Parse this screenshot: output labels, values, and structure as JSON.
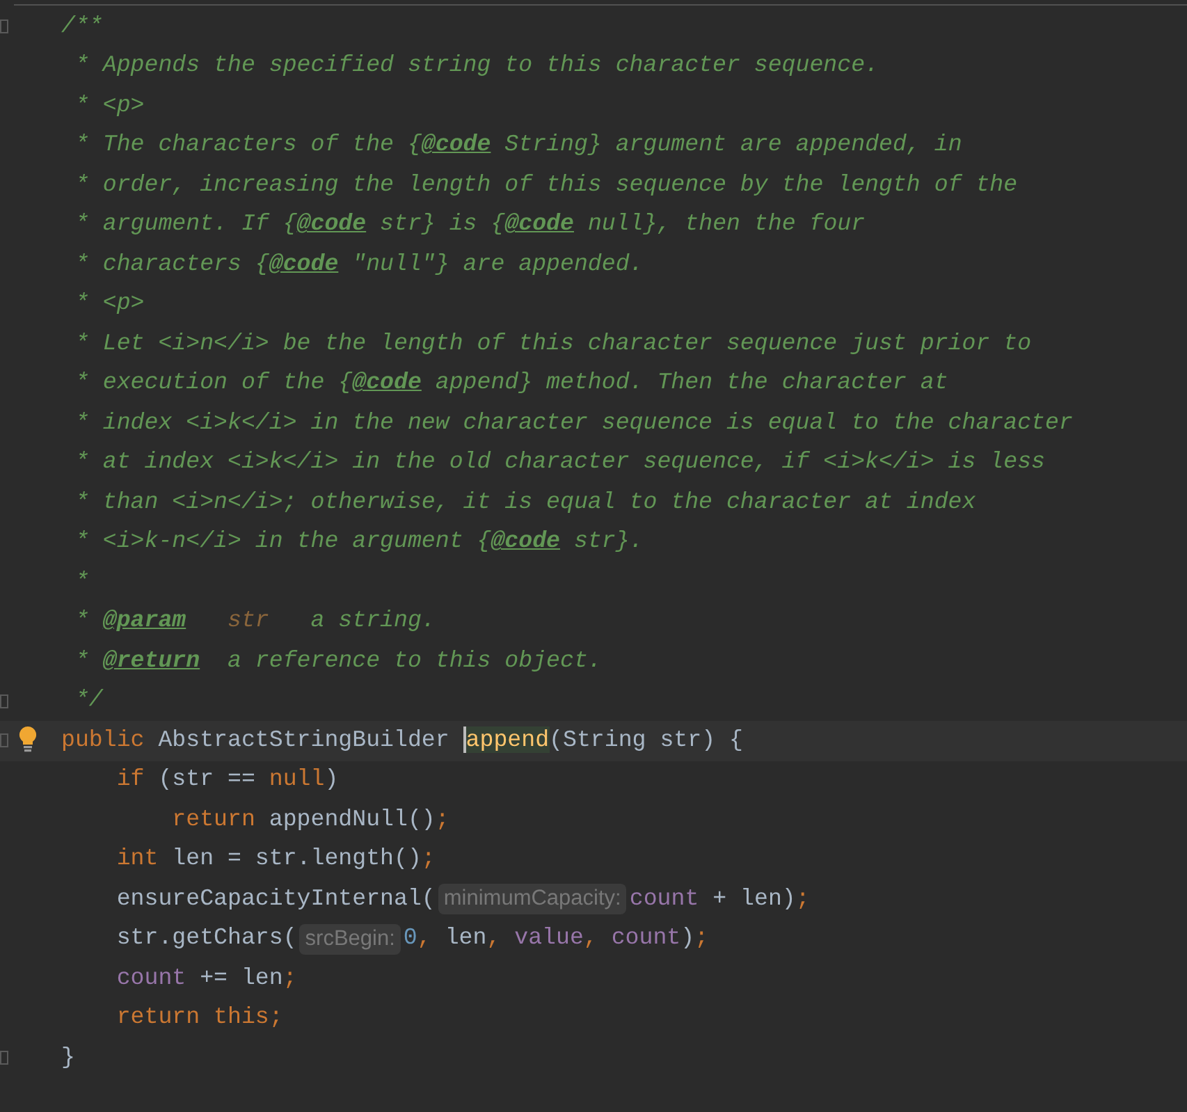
{
  "doc_comment": [
    {
      "tokens": [
        {
          "kind": "comment",
          "text": "/**"
        }
      ]
    },
    {
      "tokens": [
        {
          "kind": "comment",
          "text": " * Appends the specified string to this character sequence."
        }
      ]
    },
    {
      "tokens": [
        {
          "kind": "comment",
          "text": " * <p>"
        }
      ]
    },
    {
      "tokens": [
        {
          "kind": "comment",
          "text": " * The characters of the {"
        },
        {
          "kind": "tag",
          "text": "@code"
        },
        {
          "kind": "comment",
          "text": " String} argument are appended, in"
        }
      ]
    },
    {
      "tokens": [
        {
          "kind": "comment",
          "text": " * order, increasing the length of this sequence by the length of the"
        }
      ]
    },
    {
      "tokens": [
        {
          "kind": "comment",
          "text": " * argument. If {"
        },
        {
          "kind": "tag",
          "text": "@code"
        },
        {
          "kind": "comment",
          "text": " str} is {"
        },
        {
          "kind": "tag",
          "text": "@code"
        },
        {
          "kind": "comment",
          "text": " null}, then the four"
        }
      ]
    },
    {
      "tokens": [
        {
          "kind": "comment",
          "text": " * characters {"
        },
        {
          "kind": "tag",
          "text": "@code"
        },
        {
          "kind": "comment",
          "text": " \"null\"} are appended."
        }
      ]
    },
    {
      "tokens": [
        {
          "kind": "comment",
          "text": " * <p>"
        }
      ]
    },
    {
      "tokens": [
        {
          "kind": "comment",
          "text": " * Let <i>n</i> be the length of this character sequence just prior to"
        }
      ]
    },
    {
      "tokens": [
        {
          "kind": "comment",
          "text": " * execution of the {"
        },
        {
          "kind": "tag",
          "text": "@code"
        },
        {
          "kind": "comment",
          "text": " append} method. Then the character at"
        }
      ]
    },
    {
      "tokens": [
        {
          "kind": "comment",
          "text": " * index <i>k</i> in the new character sequence is equal to the character"
        }
      ]
    },
    {
      "tokens": [
        {
          "kind": "comment",
          "text": " * at index <i>k</i> in the old character sequence, if <i>k</i> is less"
        }
      ]
    },
    {
      "tokens": [
        {
          "kind": "comment",
          "text": " * than <i>n</i>; otherwise, it is equal to the character at index"
        }
      ]
    },
    {
      "tokens": [
        {
          "kind": "comment",
          "text": " * <i>k-n</i> in the argument {"
        },
        {
          "kind": "tag",
          "text": "@code"
        },
        {
          "kind": "comment",
          "text": " str}."
        }
      ]
    },
    {
      "tokens": [
        {
          "kind": "comment",
          "text": " *"
        }
      ]
    },
    {
      "tokens": [
        {
          "kind": "comment",
          "text": " * "
        },
        {
          "kind": "tag",
          "text": "@param"
        },
        {
          "kind": "param_name",
          "text": "   str"
        },
        {
          "kind": "comment",
          "text": "   a string."
        }
      ]
    },
    {
      "tokens": [
        {
          "kind": "comment",
          "text": " * "
        },
        {
          "kind": "tag",
          "text": "@return"
        },
        {
          "kind": "comment",
          "text": "  a reference to this object."
        }
      ]
    },
    {
      "tokens": [
        {
          "kind": "comment",
          "text": " */"
        }
      ]
    }
  ],
  "method": {
    "signature": {
      "tokens": [
        {
          "kind": "keyword",
          "text": "public"
        },
        {
          "kind": "plain",
          "text": " AbstractStringBuilder "
        },
        {
          "kind": "usage",
          "text": "append"
        },
        {
          "kind": "plain",
          "text": "(String str) {"
        }
      ]
    },
    "body": [
      {
        "tokens": [
          {
            "kind": "keyword",
            "text": "    if"
          },
          {
            "kind": "plain",
            "text": " (str == "
          },
          {
            "kind": "keyword",
            "text": "null"
          },
          {
            "kind": "plain",
            "text": ")"
          }
        ]
      },
      {
        "tokens": [
          {
            "kind": "keyword",
            "text": "        return"
          },
          {
            "kind": "plain",
            "text": " appendNull()"
          },
          {
            "kind": "keyword",
            "text": ";"
          }
        ]
      },
      {
        "tokens": [
          {
            "kind": "keyword",
            "text": "    int"
          },
          {
            "kind": "plain",
            "text": " len = str.length()"
          },
          {
            "kind": "keyword",
            "text": ";"
          }
        ]
      },
      {
        "tokens": [
          {
            "kind": "plain",
            "text": "    ensureCapacityInternal("
          },
          {
            "kind": "hint",
            "text": "minimumCapacity:"
          },
          {
            "kind": "field",
            "text": "count"
          },
          {
            "kind": "plain",
            "text": " + len)"
          },
          {
            "kind": "keyword",
            "text": ";"
          }
        ]
      },
      {
        "tokens": [
          {
            "kind": "plain",
            "text": "    str.getChars("
          },
          {
            "kind": "hint",
            "text": "srcBegin:"
          },
          {
            "kind": "number",
            "text": "0"
          },
          {
            "kind": "keyword",
            "text": ","
          },
          {
            "kind": "plain",
            "text": " len"
          },
          {
            "kind": "keyword",
            "text": ", "
          },
          {
            "kind": "field",
            "text": "value"
          },
          {
            "kind": "keyword",
            "text": ", "
          },
          {
            "kind": "field",
            "text": "count"
          },
          {
            "kind": "plain",
            "text": ")"
          },
          {
            "kind": "keyword",
            "text": ";"
          }
        ]
      },
      {
        "tokens": [
          {
            "kind": "field",
            "text": "    count"
          },
          {
            "kind": "plain",
            "text": " += len"
          },
          {
            "kind": "keyword",
            "text": ";"
          }
        ]
      },
      {
        "tokens": [
          {
            "kind": "keyword",
            "text": "    return this;"
          }
        ]
      }
    ],
    "closing": {
      "tokens": [
        {
          "kind": "plain",
          "text": "}"
        }
      ]
    }
  }
}
